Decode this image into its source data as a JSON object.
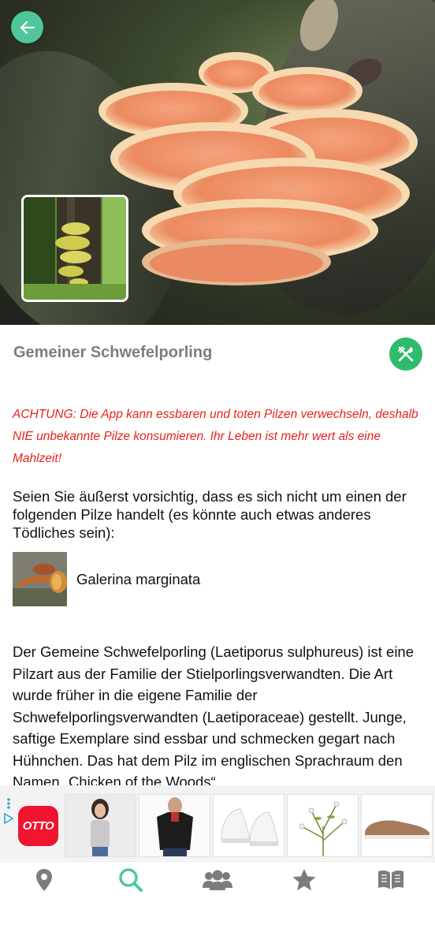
{
  "header": {
    "back_icon": "arrow-left-icon",
    "accent": "#4fc79a"
  },
  "mushroom": {
    "name": "Gemeiner Schwefelporling",
    "edibility_icon": "fork-knife-icon",
    "edibility_color": "#2fbb6c"
  },
  "warning": {
    "text": "ACHTUNG: Die App kann essbaren und toten Pilzen verwechseln, deshalb NIE unbekannte Pilze konsumieren. Ihr Leben ist mehr wert als eine Mahlzeit!",
    "color": "#e8211c"
  },
  "lookalikes": {
    "intro": "Seien Sie äußerst vorsichtig, dass es sich nicht um einen der folgenden Pilze handelt (es könnte auch etwas anderes Tödliches sein):",
    "items": [
      {
        "name": "Galerina marginata"
      }
    ]
  },
  "description": "Der Gemeine Schwefelporling (Laetiporus sulphureus) ist eine Pilzart aus der Familie der Stielporlingsverwandten. Die Art wurde früher in die eigene Familie der Schwefelporlingsverwandten (Laetiporaceae) gestellt. Junge, saftige Exemplare sind essbar und schmecken gegart nach Hühnchen. Das hat dem Pilz im englischen Sprachraum den Namen „Chicken of the Woods“",
  "ad": {
    "brand": "OTTO",
    "brand_color": "#f0142f",
    "products": [
      "top",
      "polo-shirt",
      "sneakers",
      "plant",
      "loafer"
    ]
  },
  "tabbar": {
    "tabs": [
      {
        "icon": "map-pin-icon",
        "active": false
      },
      {
        "icon": "search-icon",
        "active": true
      },
      {
        "icon": "users-icon",
        "active": false
      },
      {
        "icon": "star-icon",
        "active": false
      },
      {
        "icon": "book-icon",
        "active": false
      }
    ],
    "active_color": "#4fc79a",
    "inactive_color": "#7c7c7c"
  }
}
